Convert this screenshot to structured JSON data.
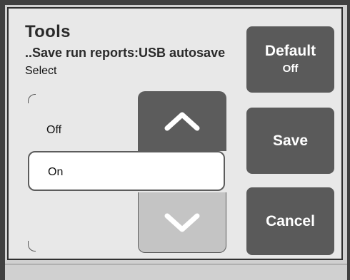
{
  "header": {
    "title": "Tools",
    "path": "..Save run reports:USB autosave",
    "instruction": "Select"
  },
  "list": {
    "items": [
      {
        "label": "Off",
        "selected": false
      },
      {
        "label": "On",
        "selected": true
      }
    ],
    "scroll_up_icon": "chevron-up-icon",
    "scroll_down_icon": "chevron-down-icon"
  },
  "buttons": {
    "default_label": "Default",
    "default_value": "Off",
    "save_label": "Save",
    "cancel_label": "Cancel"
  },
  "colors": {
    "button_bg": "#5a5a5a",
    "scroll_up_bg": "#5c5c5c",
    "scroll_down_bg": "#c4c4c4",
    "selected_item_bg": "#ffffff",
    "screen_bg": "#e8e8e8"
  }
}
